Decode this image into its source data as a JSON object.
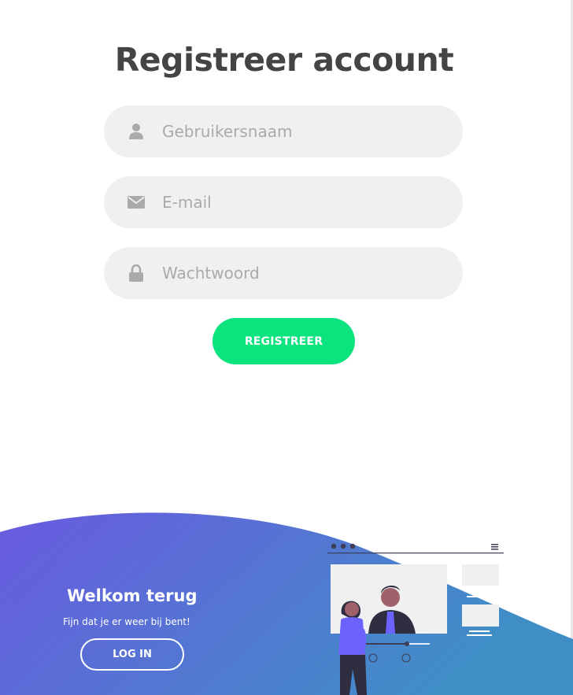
{
  "register": {
    "title": "Registreer account",
    "username_placeholder": "Gebruikersnaam",
    "email_placeholder": "E-mail",
    "password_placeholder": "Wachtwoord",
    "submit_label": "REGISTREER"
  },
  "icons": {
    "username": "user-icon",
    "email": "envelope-icon",
    "password": "lock-icon"
  },
  "welcome": {
    "title": "Welkom terug",
    "subtitle": "Fijn dat je er weer bij bent!",
    "login_label": "LOG IN"
  },
  "colors": {
    "accent_green": "#0ae37e",
    "gradient_start": "#6a5ae0",
    "gradient_end": "#3f8fc6",
    "field_bg": "#f0f0f0",
    "title_text": "#444444",
    "illustration_purple": "#6c63ff"
  }
}
